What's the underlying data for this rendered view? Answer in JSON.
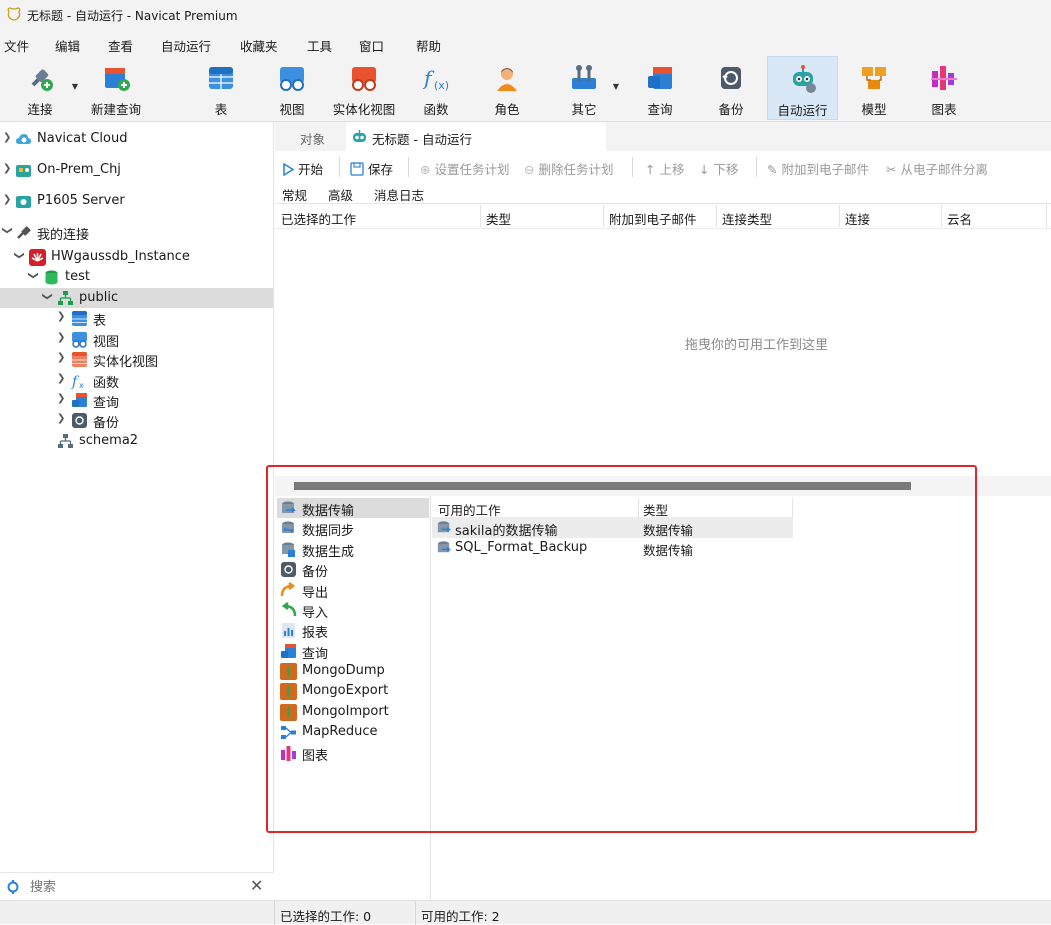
{
  "window": {
    "title": "无标题 - 自动运行 - Navicat Premium"
  },
  "menu": [
    "文件",
    "编辑",
    "查看",
    "自动运行",
    "收藏夹",
    "工具",
    "窗口",
    "帮助"
  ],
  "toolbar": {
    "connect": "连接",
    "new_query": "新建查询",
    "table": "表",
    "view": "视图",
    "mat_view": "实体化视图",
    "function": "函数",
    "role": "角色",
    "other": "其它",
    "query": "查询",
    "backup": "备份",
    "automation": "自动运行",
    "model": "模型",
    "chart": "图表"
  },
  "sidebar": {
    "connections": [
      {
        "label": "Navicat Cloud"
      },
      {
        "label": "On-Prem_Chj"
      },
      {
        "label": "P1605 Server"
      },
      {
        "label": "我的连接"
      }
    ],
    "instance": "HWgaussdb_Instance",
    "database": "test",
    "schema": "public",
    "schema_children": [
      "表",
      "视图",
      "实体化视图",
      "函数",
      "查询",
      "备份"
    ],
    "schema2": "schema2",
    "search_placeholder": "搜索"
  },
  "tabs": {
    "objects": "对象",
    "active": "无标题 - 自动运行"
  },
  "commands": {
    "start": "开始",
    "save": "保存",
    "set_schedule": "设置任务计划",
    "delete_schedule": "删除任务计划",
    "move_up": "上移",
    "move_down": "下移",
    "attach_email": "附加到电子邮件",
    "detach_email": "从电子邮件分离"
  },
  "subtabs": [
    "常规",
    "高级",
    "消息日志"
  ],
  "selected_jobs": {
    "columns": [
      "已选择的工作",
      "类型",
      "附加到电子邮件",
      "连接类型",
      "连接",
      "云名"
    ],
    "empty_hint": "拖曳你的可用工作到这里"
  },
  "job_types": [
    "数据传输",
    "数据同步",
    "数据生成",
    "备份",
    "导出",
    "导入",
    "报表",
    "查询",
    "MongoDump",
    "MongoExport",
    "MongoImport",
    "MapReduce",
    "图表"
  ],
  "available_jobs": {
    "columns": [
      "可用的工作",
      "类型"
    ],
    "rows": [
      {
        "name": "sakila的数据传输",
        "type": "数据传输"
      },
      {
        "name": "SQL_Format_Backup",
        "type": "数据传输"
      }
    ]
  },
  "status": {
    "selected": "已选择的工作: 0",
    "available": "可用的工作: 2"
  },
  "colors": {
    "highlight_border": "#e0252b",
    "active_tool": "#d9e8f7",
    "selection": "#dcdcdc"
  }
}
